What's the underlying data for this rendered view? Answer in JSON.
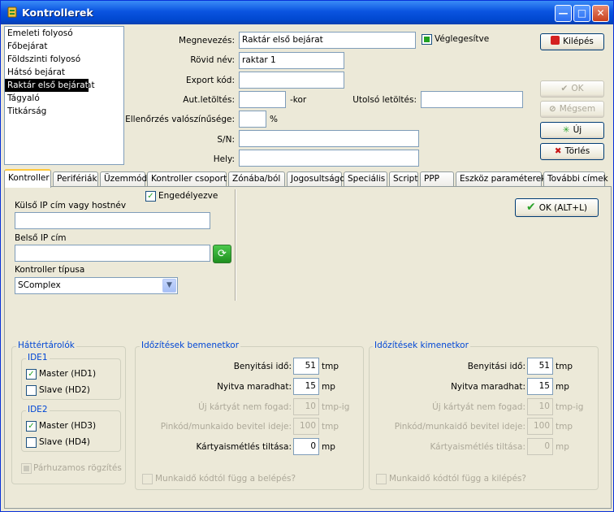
{
  "window": {
    "title": "Kontrollerek"
  },
  "list_items": [
    "Emeleti folyosó",
    "Főbejárat",
    "Földszinti folyosó",
    "Hátsó bejárat",
    "Raktár első bejárat",
    "Raktár hátsó bejárat",
    "Tágyaló",
    "Titkárság"
  ],
  "selected_index": 4,
  "form": {
    "megnevezes_label": "Megnevezés:",
    "megnevezes_value": "Raktár első bejárat",
    "veglegesitve_label": "Véglegesítve",
    "rovid_nev_label": "Rövid név:",
    "rovid_nev_value": "raktar 1",
    "export_kod_label": "Export kód:",
    "aut_letoltes_label": "Aut.letöltés:",
    "kor_label": "-kor",
    "utolso_letoltes_label": "Utolsó letöltés:",
    "ellenorzes_label": "Ellenőrzés valószínűsége:",
    "percent_label": "%",
    "sn_label": "S/N:",
    "hely_label": "Hely:"
  },
  "buttons": {
    "kilepes": "Kilépés",
    "ok": "OK",
    "megses": "Mégsem",
    "uj": "Új",
    "torles": "Törlés",
    "ok_alt": "OK (ALT+L)"
  },
  "tabs": [
    "Kontroller",
    "Perifériák",
    "Üzemmód",
    "Kontroller csoport",
    "Zónába/ból",
    "Jogosultságok",
    "Speciális",
    "Script",
    "PPP",
    "Eszköz paraméterek",
    "További címek"
  ],
  "kontroller": {
    "engedelyezve_label": "Engedélyezve",
    "kulso_ip_label": "Külső IP cím vagy hostnév",
    "kulso_ip_value": "",
    "belso_ip_label": "Belső IP cím",
    "belso_ip_value": "",
    "tipus_label": "Kontroller típusa",
    "tipus_value": "SComplex"
  },
  "hattertarolok": {
    "title": "Háttértárolók",
    "ide1": "IDE1",
    "master_hd1": "Master (HD1)",
    "slave_hd2": "Slave (HD2)",
    "ide2": "IDE2",
    "master_hd3": "Master (HD3)",
    "slave_hd4": "Slave (HD4)",
    "parhuzamos": "Párhuzamos rögzítés"
  },
  "bemenet": {
    "title": "Időzítések bemenetkor",
    "benyitasi_label": "Benyitási idő:",
    "benyitasi_value": "51",
    "benyitasi_unit": "tmp",
    "nyitva_label": "Nyitva maradhat:",
    "nyitva_value": "15",
    "nyitva_unit": "mp",
    "uj_kartya_label": "Új kártyát nem fogad:",
    "uj_kartya_value": "10",
    "uj_kartya_unit": "tmp-ig",
    "pinkod_label": "Pinkód/munkaido bevitel ideje:",
    "pinkod_value": "100",
    "pinkod_unit": "tmp",
    "kartyaism_label": "Kártyaismétlés tiltása:",
    "kartyaism_value": "0",
    "kartyaism_unit": "mp",
    "munkaido_label": "Munkaidő kódtól függ a belépés?"
  },
  "kimenet": {
    "title": "Időzítések kimenetkor",
    "benyitasi_label": "Benyitási idő:",
    "benyitasi_value": "51",
    "benyitasi_unit": "tmp",
    "nyitva_label": "Nyitva maradhat:",
    "nyitva_value": "15",
    "nyitva_unit": "mp",
    "uj_kartya_label": "Új kártyát nem fogad:",
    "uj_kartya_value": "10",
    "uj_kartya_unit": "tmp-ig",
    "pinkod_label": "Pinkód/munkaidő bevitel ideje:",
    "pinkod_value": "100",
    "pinkod_unit": "tmp",
    "kartyaism_label": "Kártyaismétlés tiltása:",
    "kartyaism_value": "0",
    "kartyaism_unit": "mp",
    "munkaido_label": "Munkaidő kódtól függ a kilépés?"
  }
}
